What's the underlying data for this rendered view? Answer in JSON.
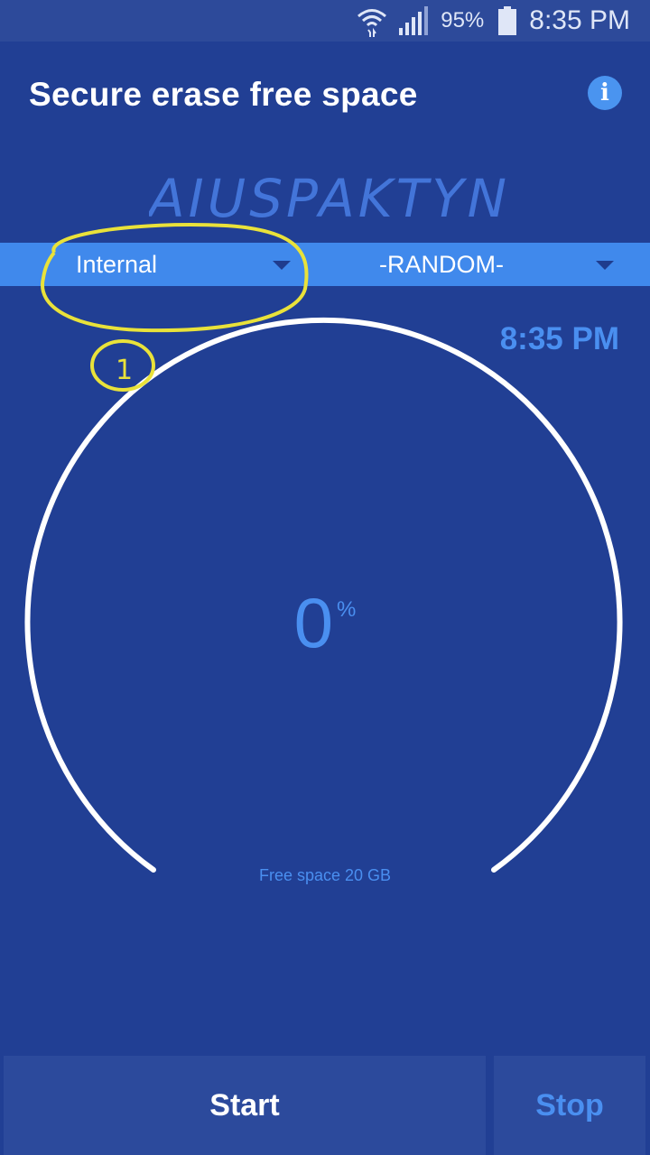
{
  "status_bar": {
    "battery_percent": "95%",
    "time": "8:35 PM",
    "icons": [
      "wifi-icon",
      "signal-icon",
      "battery-icon"
    ]
  },
  "header": {
    "title": "Secure erase free space",
    "info_icon": "info-icon"
  },
  "watermark": {
    "text": "AIUSPAKTYN"
  },
  "dropdowns": {
    "storage": {
      "selected": "Internal"
    },
    "method": {
      "selected": "-RANDOM-"
    }
  },
  "annotation": {
    "label": "1",
    "color": "#e9e23a"
  },
  "main": {
    "time": "8:35 PM",
    "progress_value": "0",
    "progress_unit": "%",
    "progress_fraction": 0,
    "free_space": "Free space 20 GB"
  },
  "buttons": {
    "start_label": "Start",
    "stop_label": "Stop"
  },
  "colors": {
    "background": "#213f94",
    "accent": "#4a8ff0",
    "dropdown_bar": "#4089ec",
    "button_bg": "#2c4a9c"
  }
}
